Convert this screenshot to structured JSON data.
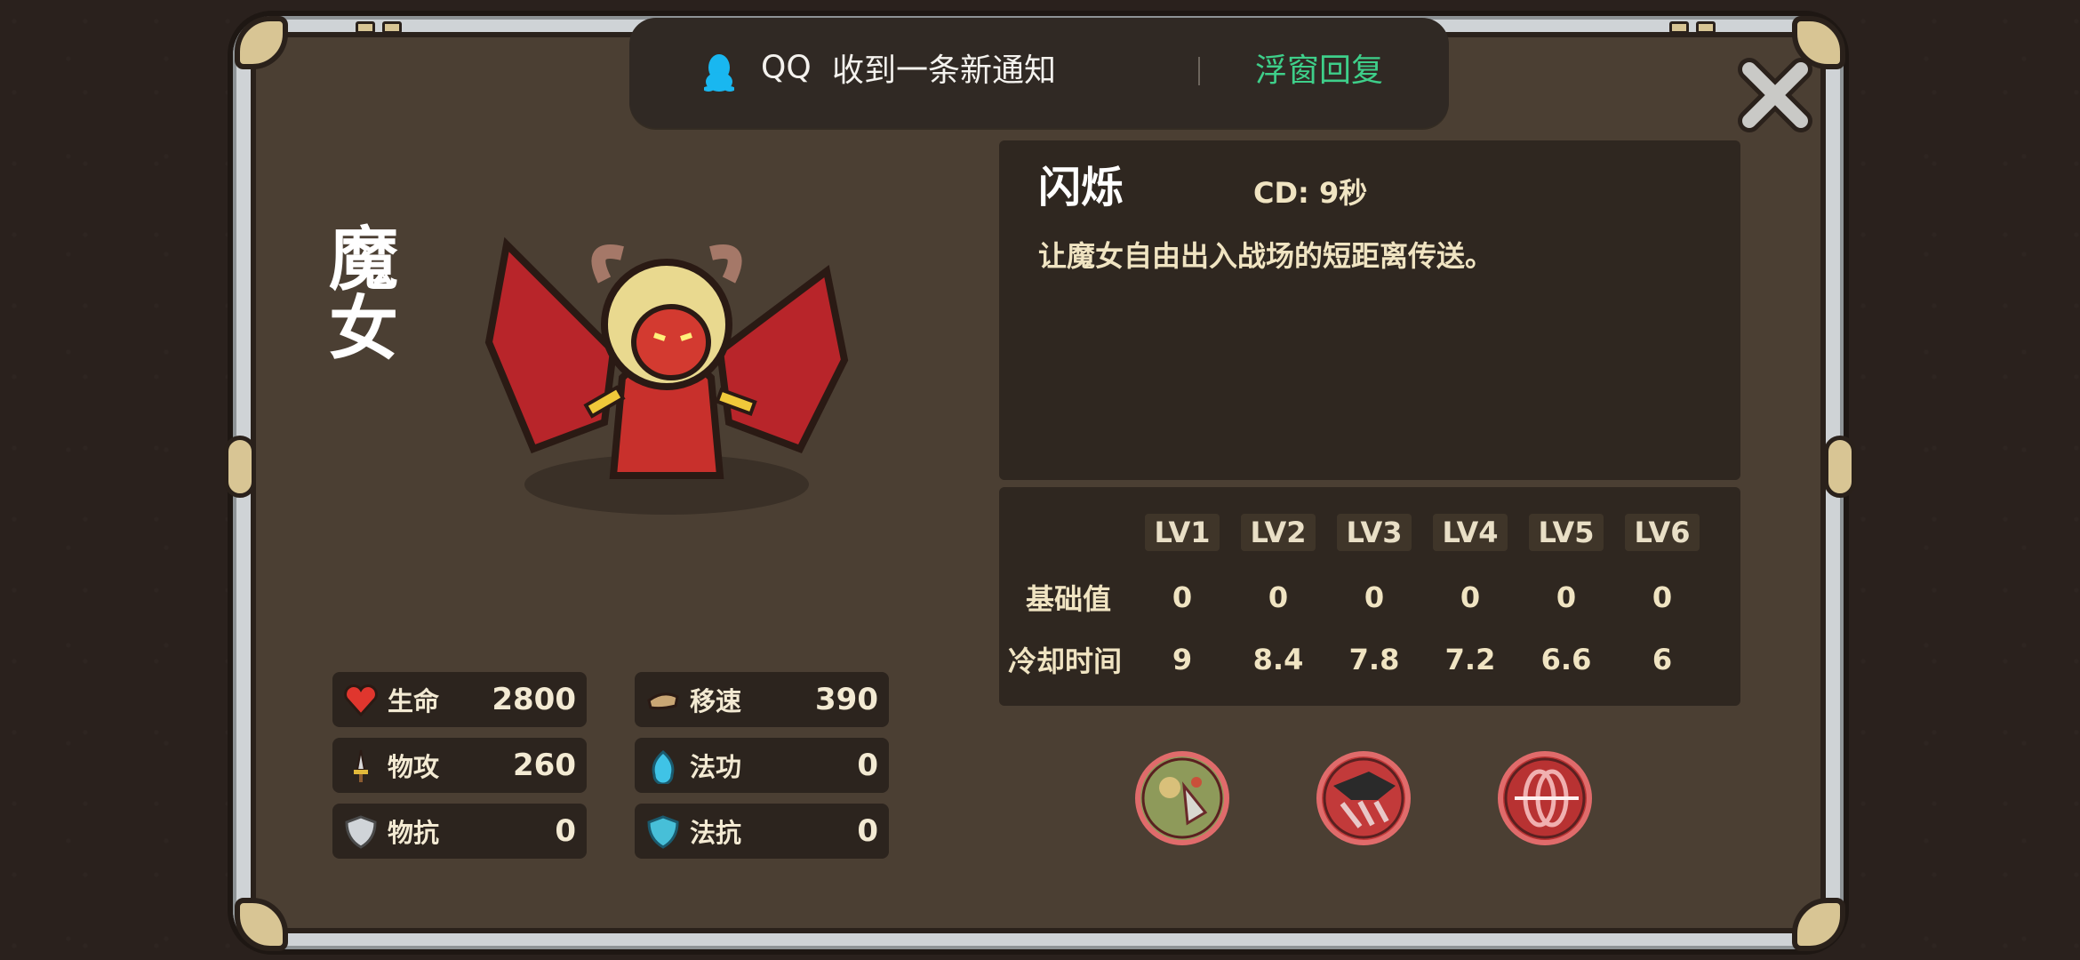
{
  "notification": {
    "app": "QQ",
    "message": "收到一条新通知",
    "action": "浮窗回复"
  },
  "hero": {
    "name": "魔女"
  },
  "stats": [
    {
      "icon": "heart-icon",
      "label": "生命",
      "value": "2800"
    },
    {
      "icon": "boots-icon",
      "label": "移速",
      "value": "390"
    },
    {
      "icon": "sword-icon",
      "label": "物攻",
      "value": "260"
    },
    {
      "icon": "magic-orb-icon",
      "label": "法功",
      "value": "0"
    },
    {
      "icon": "silver-shield-icon",
      "label": "物抗",
      "value": "0"
    },
    {
      "icon": "blue-shield-icon",
      "label": "法抗",
      "value": "0"
    }
  ],
  "skill": {
    "name": "闪烁",
    "cd": "CD: 9秒",
    "description": "让魔女自由出入战场的短距离传送。"
  },
  "levels": {
    "headers": [
      "LV1",
      "LV2",
      "LV3",
      "LV4",
      "LV5",
      "LV6"
    ],
    "rows": [
      {
        "label": "基础值",
        "values": [
          "0",
          "0",
          "0",
          "0",
          "0",
          "0"
        ]
      },
      {
        "label": "冷却时间",
        "values": [
          "9",
          "8.4",
          "7.8",
          "7.2",
          "6.6",
          "6"
        ]
      }
    ]
  },
  "skill_icons": [
    "skill-icon-1",
    "skill-icon-2",
    "skill-icon-3"
  ]
}
